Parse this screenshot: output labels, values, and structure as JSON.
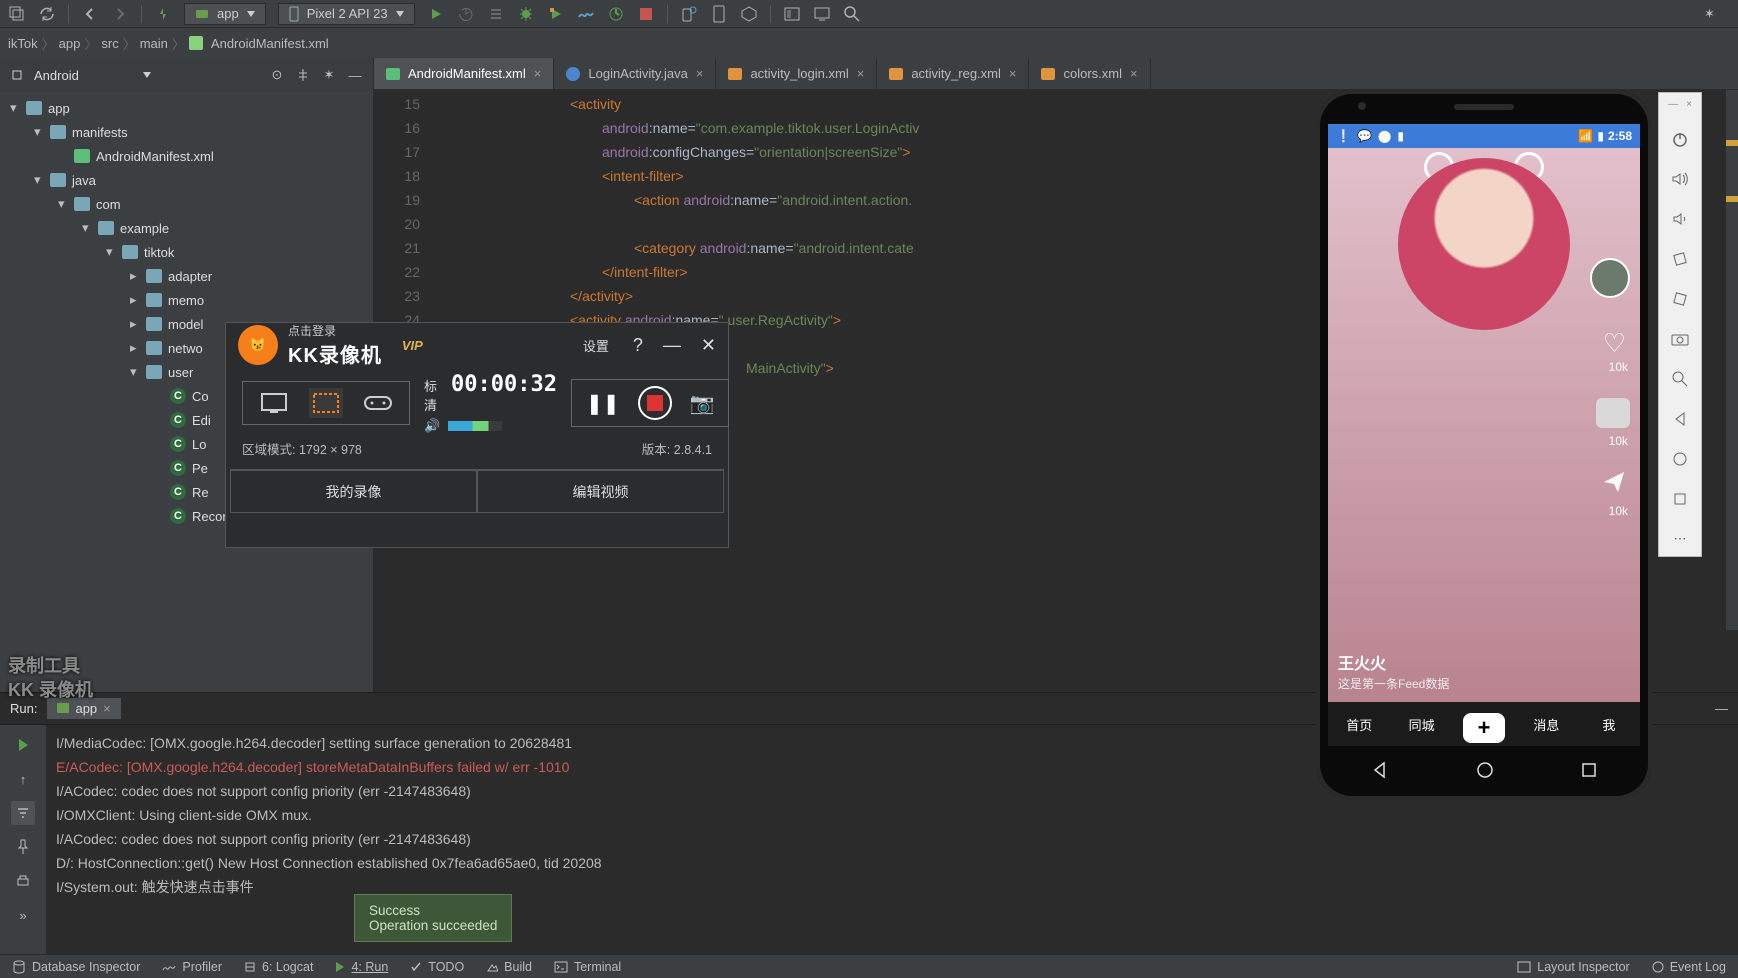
{
  "toolbar": {
    "app_label": "app",
    "device_label": "Pixel 2 API 23"
  },
  "breadcrumbs": [
    "ikTok",
    "app",
    "src",
    "main",
    "AndroidManifest.xml"
  ],
  "project": {
    "view": "Android",
    "tree": [
      {
        "l": 0,
        "label": "app",
        "fld": true,
        "open": true
      },
      {
        "l": 1,
        "label": "manifests",
        "fld": true,
        "open": true
      },
      {
        "l": 2,
        "label": "AndroidManifest.xml",
        "file": "mf"
      },
      {
        "l": 1,
        "label": "java",
        "fld": true,
        "open": true
      },
      {
        "l": 2,
        "label": "com",
        "pkg": true,
        "open": true
      },
      {
        "l": 3,
        "label": "example",
        "pkg": true,
        "open": true
      },
      {
        "l": 4,
        "label": "tiktok",
        "pkg": true,
        "open": true
      },
      {
        "l": 5,
        "label": "adapter",
        "pkg": true,
        "closed": true
      },
      {
        "l": 5,
        "label": "memo",
        "pkg": true,
        "closed": true,
        "cut": true
      },
      {
        "l": 5,
        "label": "model",
        "pkg": true,
        "closed": true,
        "cut": true
      },
      {
        "l": 5,
        "label": "netwo",
        "pkg": true,
        "closed": true,
        "cut": true
      },
      {
        "l": 5,
        "label": "user",
        "pkg": true,
        "open": true
      },
      {
        "l": 6,
        "label": "Co",
        "cls": true,
        "cut": true
      },
      {
        "l": 6,
        "label": "Edi",
        "cls": true,
        "cut": true
      },
      {
        "l": 6,
        "label": "Lo",
        "cls": true,
        "cut": true
      },
      {
        "l": 6,
        "label": "Pe",
        "cls": true,
        "cut": true
      },
      {
        "l": 6,
        "label": "Re",
        "cls": true,
        "cut": true
      },
      {
        "l": 6,
        "label": "RecordDao",
        "cls": true,
        "cut": true
      }
    ]
  },
  "tabs": [
    {
      "label": "AndroidManifest.xml",
      "type": "mf",
      "active": true
    },
    {
      "label": "LoginActivity.java",
      "type": "jv"
    },
    {
      "label": "activity_login.xml",
      "type": "xm"
    },
    {
      "label": "activity_reg.xml",
      "type": "xm"
    },
    {
      "label": "colors.xml",
      "type": "xm"
    }
  ],
  "gutter_start": 15,
  "code_lines": [
    {
      "parts": [
        {
          "t": "<activity",
          "c": "tag"
        }
      ]
    },
    {
      "indent": 4,
      "parts": [
        {
          "t": "android",
          "c": "attr"
        },
        {
          "t": ":name=",
          "c": "brk"
        },
        {
          "t": "\"com.example.tiktok.user.LoginActiv",
          "c": "str"
        }
      ]
    },
    {
      "indent": 4,
      "parts": [
        {
          "t": "android",
          "c": "attr"
        },
        {
          "t": ":configChanges=",
          "c": "brk"
        },
        {
          "t": "\"orientation|screenSize\"",
          "c": "str"
        },
        {
          "t": ">",
          "c": "tag"
        }
      ]
    },
    {
      "indent": 4,
      "parts": [
        {
          "t": "<intent-filter>",
          "c": "tag"
        }
      ]
    },
    {
      "indent": 8,
      "parts": [
        {
          "t": "<action ",
          "c": "tag"
        },
        {
          "t": "android",
          "c": "attr"
        },
        {
          "t": ":name=",
          "c": "brk"
        },
        {
          "t": "\"android.intent.action.",
          "c": "str"
        }
      ]
    },
    {
      "parts": []
    },
    {
      "indent": 8,
      "parts": [
        {
          "t": "<category ",
          "c": "tag"
        },
        {
          "t": "android",
          "c": "attr"
        },
        {
          "t": ":name=",
          "c": "brk"
        },
        {
          "t": "\"android.intent.cate",
          "c": "str"
        }
      ]
    },
    {
      "indent": 4,
      "parts": [
        {
          "t": "</intent-filter>",
          "c": "tag"
        }
      ]
    },
    {
      "parts": [
        {
          "t": "</activity>",
          "c": "tag"
        }
      ]
    },
    {
      "parts": [
        {
          "t": "<activity ",
          "c": "tag"
        },
        {
          "t": "android",
          "c": "attr"
        },
        {
          "t": ":name=",
          "c": "brk"
        },
        {
          "t": "\"",
          "c": "str"
        },
        {
          "t": ".user.RegActivity",
          "c": "str"
        },
        {
          "t": "\"",
          "c": "str"
        },
        {
          "t": ">",
          "c": "tag"
        }
      ]
    },
    {
      "parts": []
    },
    {
      "indent": 22,
      "parts": [
        {
          "t": "MainActivity",
          "c": "str"
        },
        {
          "t": "\"",
          "c": "str"
        },
        {
          "t": ">",
          "c": "tag"
        }
      ]
    }
  ],
  "recorder": {
    "login": "点击登录",
    "vip": "VIP",
    "settings": "设置",
    "brand": "KK录像机",
    "quality": "标清",
    "time": "00:00:32",
    "mode_label": "区域模式:",
    "mode_value": "1792 × 978",
    "version_label": "版本:",
    "version_value": "2.8.4.1",
    "my_rec": "我的录像",
    "edit_vid": "编辑视频"
  },
  "run": {
    "title": "Run:",
    "tab": "app",
    "logs": [
      {
        "c": "",
        "t": "I/MediaCodec: [OMX.google.h264.decoder] setting surface generation to 20628481"
      },
      {
        "c": "err",
        "t": "E/ACodec: [OMX.google.h264.decoder] storeMetaDataInBuffers failed w/ err -1010"
      },
      {
        "c": "",
        "t": "I/ACodec: codec does not support config priority (err -2147483648)"
      },
      {
        "c": "",
        "t": "I/OMXClient: Using client-side OMX mux."
      },
      {
        "c": "",
        "t": "I/ACodec: codec does not support config priority (err -2147483648)"
      },
      {
        "c": "",
        "t": "D/: HostConnection::get() New Host Connection established 0x7fea6ad65ae0, tid 20208"
      },
      {
        "c": "",
        "t": "I/System.out: 触发快速点击事件"
      }
    ]
  },
  "toast": {
    "l1": "Success",
    "l2": "Operation succeeded"
  },
  "watermark": {
    "l1": "录制工具",
    "l2": "KK 录像机"
  },
  "bottom": {
    "db": "Database Inspector",
    "prof": "Profiler",
    "logcat": "6: Logcat",
    "run": "4: Run",
    "todo": "TODO",
    "build": "Build",
    "term": "Terminal",
    "layout": "Layout Inspector",
    "event": "Event Log"
  },
  "emulator": {
    "status_time": "2:58",
    "feed": {
      "user": "王火火",
      "desc": "这是第一条Feed数据",
      "count": "10k"
    },
    "nav": [
      "首页",
      "同城",
      "",
      "消息",
      "我"
    ]
  }
}
